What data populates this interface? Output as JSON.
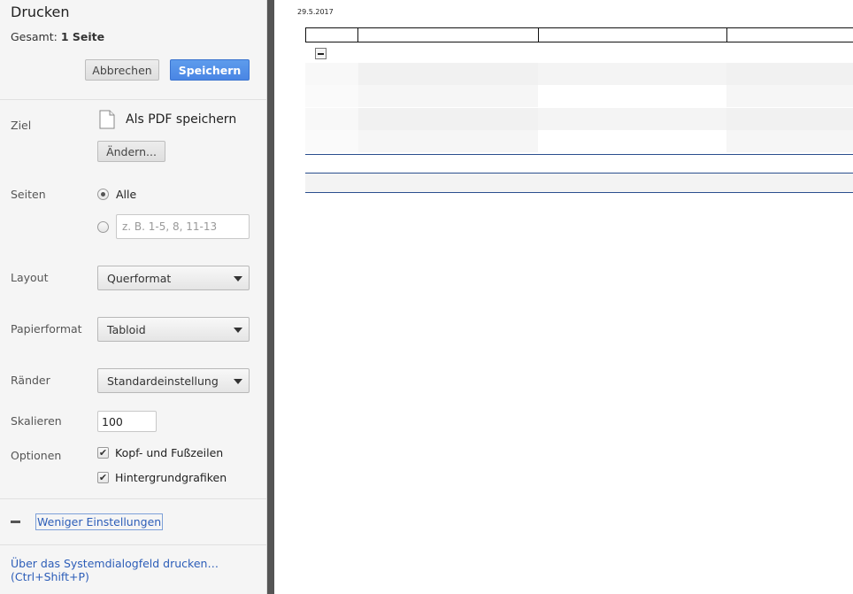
{
  "sidebar": {
    "title": "Drucken",
    "total_prefix": "Gesamt:",
    "total_value": "1 Seite",
    "cancel_label": "Abbrechen",
    "save_label": "Speichern",
    "destination": {
      "label": "Ziel",
      "name": "Als PDF speichern",
      "change_label": "Ändern..."
    },
    "pages": {
      "label": "Seiten",
      "all_label": "Alle",
      "range_placeholder": "z. B. 1-5, 8, 11-13"
    },
    "layout": {
      "label": "Layout",
      "value": "Querformat"
    },
    "paper": {
      "label": "Papierformat",
      "value": "Tabloid"
    },
    "margins": {
      "label": "Ränder",
      "value": "Standardeinstellung"
    },
    "scale": {
      "label": "Skalieren",
      "value": "100"
    },
    "options": {
      "label": "Optionen",
      "headers_footers": "Kopf- und Fußzeilen",
      "background_graphics": "Hintergrundgrafiken"
    },
    "less_settings": "Weniger Einstellungen",
    "system_dialog_line1": "Über das Systemdialogfeld drucken…",
    "system_dialog_line2": "(Ctrl+Shift+P)"
  },
  "preview": {
    "date": "29.5.2017"
  },
  "colors": {
    "accent": "#4a86e4",
    "link": "#2c5db8",
    "table_rule": "#2b4f8e"
  }
}
